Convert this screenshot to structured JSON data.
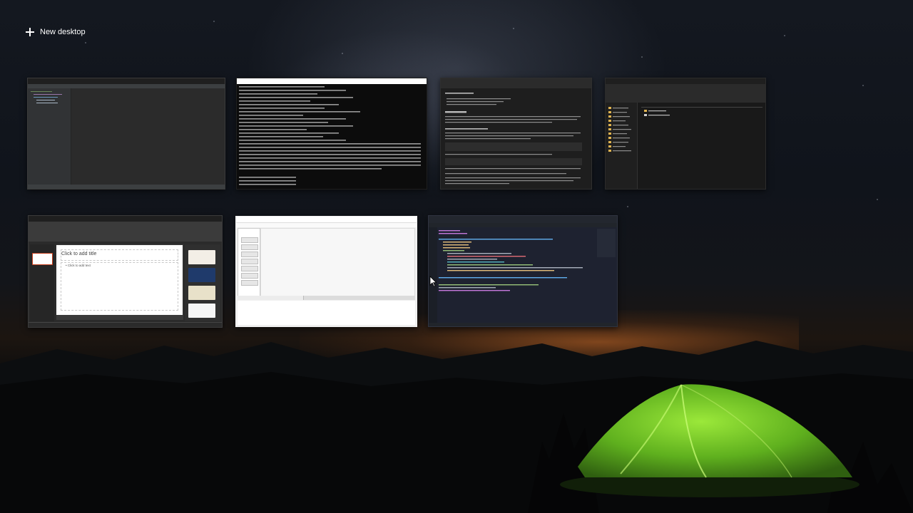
{
  "toolbar": {
    "new_desktop_label": "New desktop",
    "new_desktop_icon": "plus-icon"
  },
  "windows": [
    {
      "app": "PyCharm",
      "theme": "dark"
    },
    {
      "app": "Terminal",
      "theme": "dark"
    },
    {
      "app": "Browser",
      "theme": "dark"
    },
    {
      "app": "File Explorer",
      "theme": "dark"
    },
    {
      "app": "PowerPoint",
      "theme": "dark",
      "slide_title_placeholder": "Click to add title",
      "slide_body_placeholder": "• Click to add text"
    },
    {
      "app": "Application window",
      "theme": "light"
    },
    {
      "app": "Code editor",
      "theme": "dark"
    }
  ],
  "wallpaper": {
    "scene": "night sky with milky way, mountains and glowing green tent",
    "colors": {
      "sky": "#141820",
      "horizon_glow": "#d26e28",
      "tent": "#7bd12a"
    }
  }
}
